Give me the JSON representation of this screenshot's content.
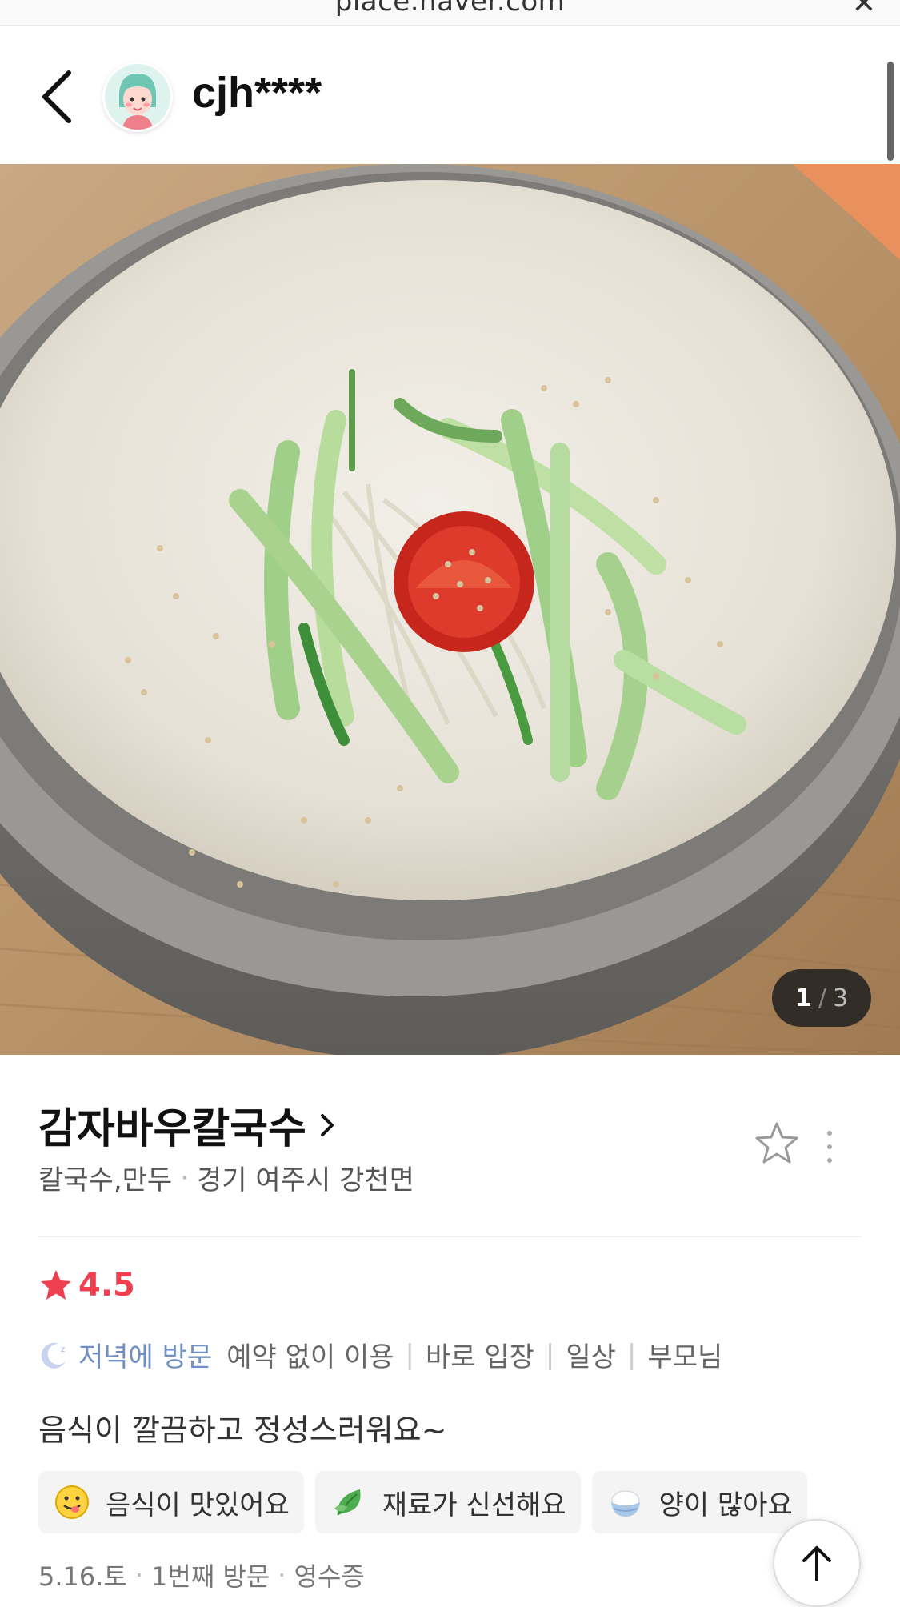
{
  "browser": {
    "url": "place.naver.com",
    "close_icon": "close-icon"
  },
  "header": {
    "username": "cjh****",
    "back_icon": "chevron-left-icon",
    "avatar_icon": "avatar"
  },
  "photo": {
    "index": "1",
    "separator": "/",
    "total": "3",
    "description_icon": "food-photo"
  },
  "place": {
    "name": "감자바우칼국수",
    "category": "칼국수,만두",
    "location": "경기 여주시 강천면",
    "separator": "·"
  },
  "review": {
    "rating": "4.5",
    "visit_time": "저녁에 방문",
    "tags": [
      "예약 없이 이용",
      "바로 입장",
      "일상",
      "부모님"
    ],
    "text": "음식이 깔끔하고 정성스러워요~",
    "keywords": [
      {
        "icon": "smiley-icon",
        "label": "음식이 맛있어요"
      },
      {
        "icon": "leaf-icon",
        "label": "재료가 신선해요"
      },
      {
        "icon": "rice-bowl-icon",
        "label": "양이 많아요"
      }
    ],
    "date": "5.16.토",
    "visit_count": "1번째 방문",
    "proof": "영수증"
  },
  "colors": {
    "rating": "#f0404f",
    "visit_time": "#6f8fc7"
  }
}
